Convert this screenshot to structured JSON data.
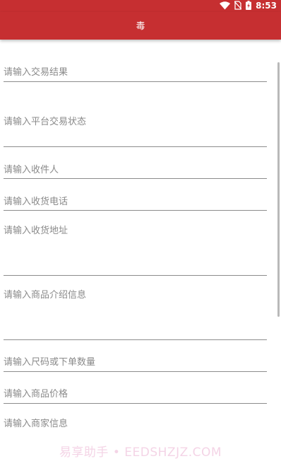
{
  "status_bar": {
    "time": "8:53",
    "icons": [
      "wifi-icon",
      "no-sim-icon",
      "battery-charging-icon"
    ]
  },
  "app_bar": {
    "title": "毒"
  },
  "form": {
    "fields": [
      {
        "placeholder": "请输入交易结果"
      },
      {
        "placeholder": "请输入平台交易状态"
      },
      {
        "placeholder": "请输入收件人"
      },
      {
        "placeholder": "请输入收货电话"
      },
      {
        "placeholder": "请输入收货地址"
      },
      {
        "placeholder": "请输入商品介绍信息"
      },
      {
        "placeholder": "请输入尺码或下单数量"
      },
      {
        "placeholder": "请输入商品价格"
      },
      {
        "placeholder": "请输入商家信息"
      }
    ]
  },
  "watermark": {
    "text": "易享助手 • EEDSHZJZ.COM"
  },
  "colors": {
    "accent": "#c62f31",
    "divider": "#8c8c8c",
    "placeholder": "#8a8a8a"
  }
}
